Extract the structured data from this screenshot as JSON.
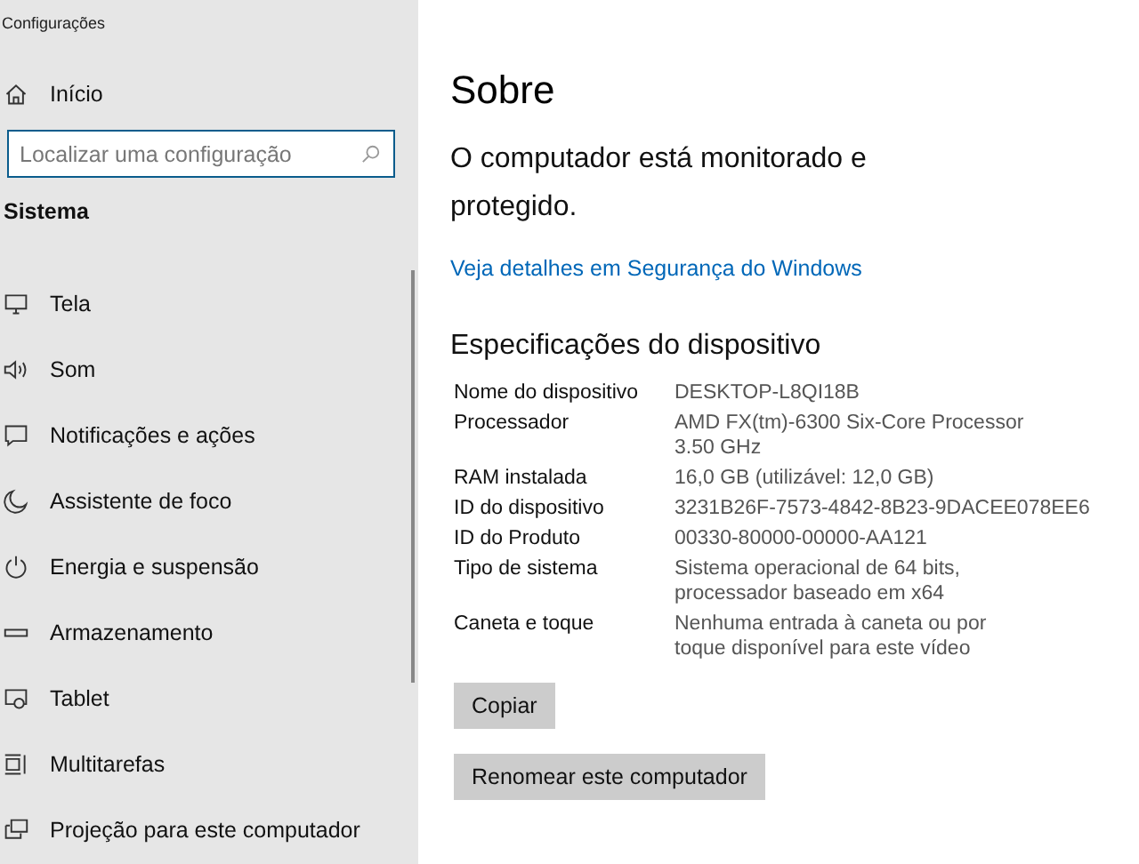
{
  "window": {
    "title": "Configurações"
  },
  "home": {
    "label": "Início"
  },
  "search": {
    "placeholder": "Localizar uma configuração"
  },
  "section": "Sistema",
  "nav": [
    {
      "label": "Tela"
    },
    {
      "label": "Som"
    },
    {
      "label": "Notificações e ações"
    },
    {
      "label": "Assistente de foco"
    },
    {
      "label": "Energia e suspensão"
    },
    {
      "label": "Armazenamento"
    },
    {
      "label": "Tablet"
    },
    {
      "label": "Multitarefas"
    },
    {
      "label": "Projeção para este computador"
    }
  ],
  "page_title": "Sobre",
  "status": "O computador está monitorado e protegido.",
  "link": "Veja detalhes em Segurança do Windows",
  "specs_title": "Especificações do dispositivo",
  "specs": [
    {
      "label": "Nome do dispositivo",
      "value": "DESKTOP-L8QI18B"
    },
    {
      "label": "Processador",
      "value": "AMD FX(tm)-6300 Six-Core Processor 3.50 GHz"
    },
    {
      "label": "RAM instalada",
      "value": "16,0 GB (utilizável: 12,0 GB)"
    },
    {
      "label": "ID do dispositivo",
      "value": "3231B26F-7573-4842-8B23-9DACEE078EE6"
    },
    {
      "label": "ID do Produto",
      "value": "00330-80000-00000-AA121"
    },
    {
      "label": "Tipo de sistema",
      "value": "Sistema operacional de 64 bits, processador baseado em x64"
    },
    {
      "label": "Caneta e toque",
      "value": "Nenhuma entrada à caneta ou por toque disponível para este vídeo"
    }
  ],
  "buttons": [
    "Copiar",
    "Renomear este computador"
  ]
}
